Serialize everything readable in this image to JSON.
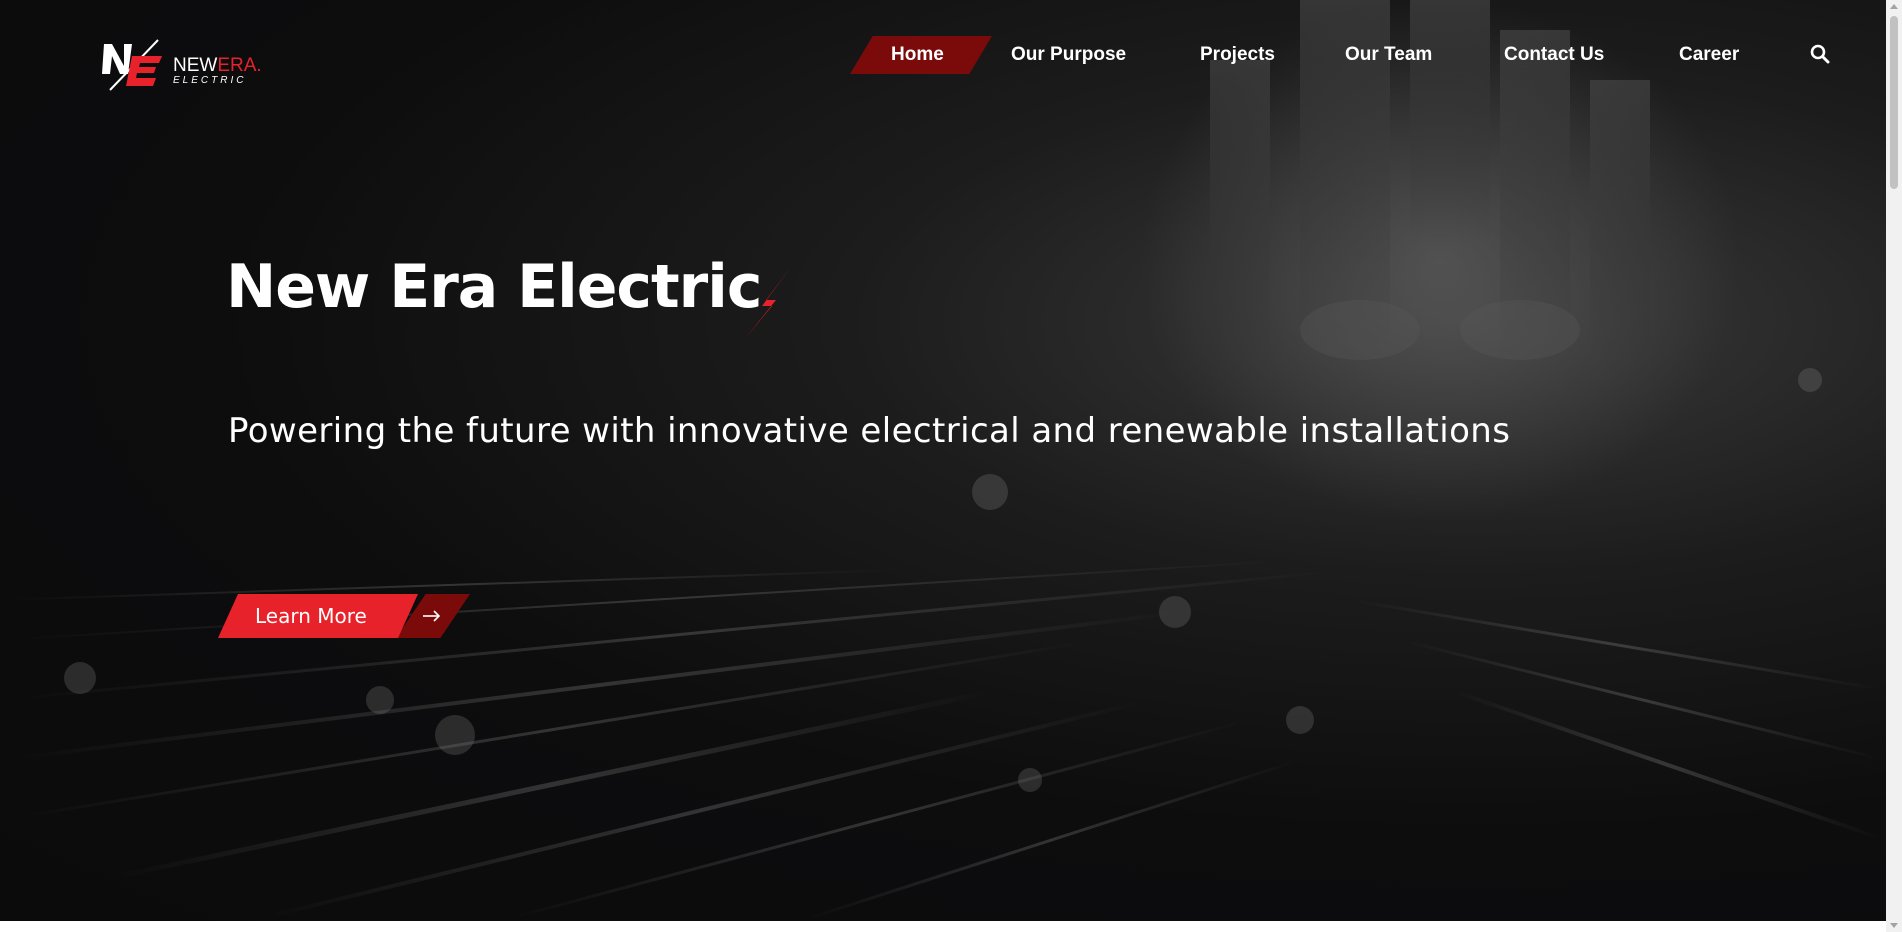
{
  "brand": {
    "mark": "NE",
    "word_new": "NEW",
    "word_era": "ERA",
    "word_dot": ".",
    "sub": "ELECTRIC",
    "accent_color": "#e8222a",
    "dark_accent_color": "#7b0a0a"
  },
  "nav": {
    "items": [
      {
        "label": "Home",
        "active": true
      },
      {
        "label": "Our Purpose",
        "active": false
      },
      {
        "label": "Projects",
        "active": false
      },
      {
        "label": "Our Team",
        "active": false
      },
      {
        "label": "Contact Us",
        "active": false
      },
      {
        "label": "Career",
        "active": false
      }
    ],
    "search_icon": "search-icon"
  },
  "hero": {
    "title": "New Era Electric",
    "title_icon": "lightning-bolt-icon",
    "subtitle": "Powering the future with innovative electrical and renewable installations",
    "cta_label": "Learn More",
    "cta_icon": "arrow-right-icon"
  }
}
